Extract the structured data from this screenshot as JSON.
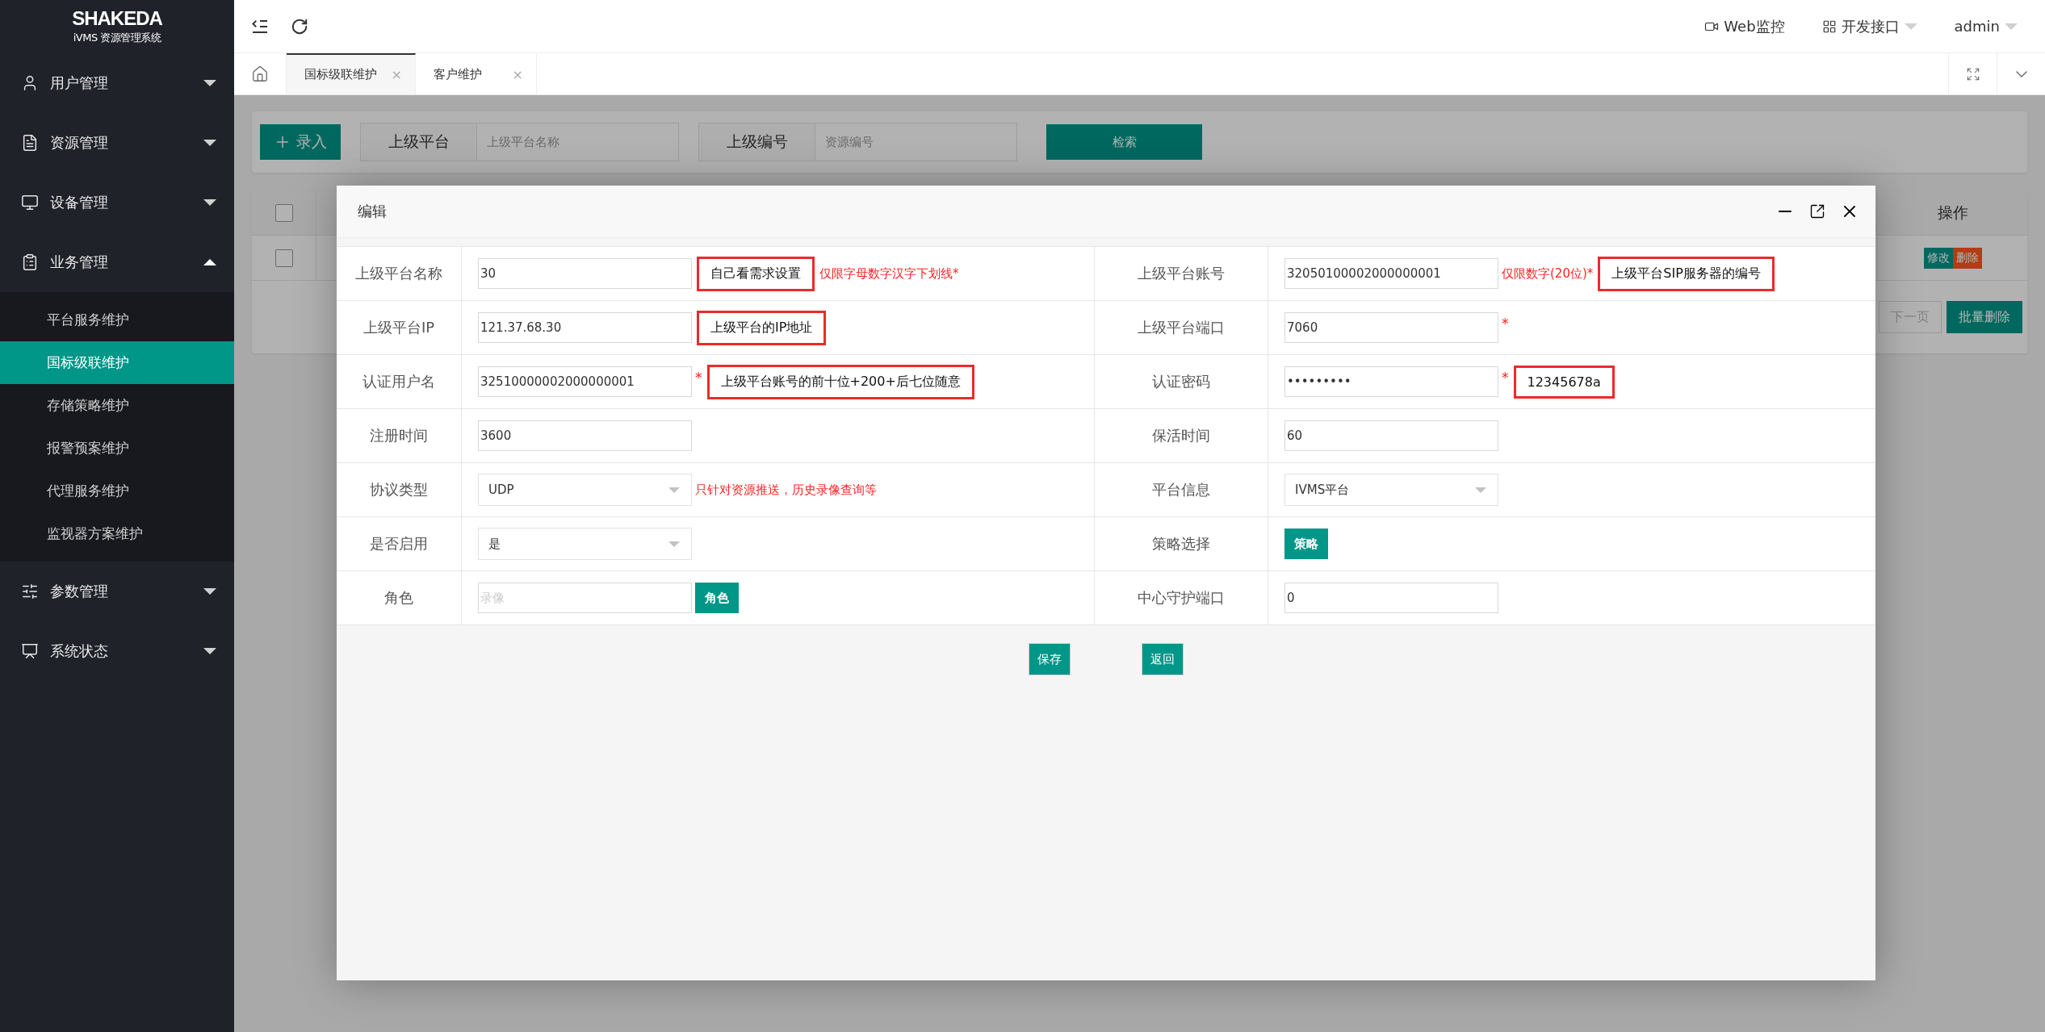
{
  "sidebar": {
    "logo": {
      "brand": "SHAKEDA",
      "subtitle": "iVMS 资源管理系统"
    },
    "items": [
      {
        "label": "用户管理",
        "expanded": false
      },
      {
        "label": "资源管理",
        "expanded": false
      },
      {
        "label": "设备管理",
        "expanded": false
      },
      {
        "label": "业务管理",
        "expanded": true,
        "children": [
          {
            "label": "平台服务维护",
            "selected": false
          },
          {
            "label": "国标级联维护",
            "selected": true
          },
          {
            "label": "存储策略维护",
            "selected": false
          },
          {
            "label": "报警预案维护",
            "selected": false
          },
          {
            "label": "代理服务维护",
            "selected": false
          },
          {
            "label": "监视器方案维护",
            "selected": false
          }
        ]
      },
      {
        "label": "参数管理",
        "expanded": false
      },
      {
        "label": "系统状态",
        "expanded": false
      }
    ]
  },
  "topbar": {
    "links": [
      {
        "label": "Web监控",
        "dropdown": false
      },
      {
        "label": "开发接口",
        "dropdown": true
      },
      {
        "label": "admin",
        "dropdown": true
      }
    ]
  },
  "tabs": [
    {
      "label": "国标级联维护",
      "close": "×",
      "selected": true
    },
    {
      "label": "客户维护",
      "close": "×",
      "selected": false
    }
  ],
  "toolbar": {
    "add_button": "录入",
    "filters": [
      {
        "label": "上级平台",
        "placeholder": "上级平台名称"
      },
      {
        "label": "上级编号",
        "placeholder": "资源编号"
      }
    ],
    "search_button": "检索"
  },
  "table": {
    "header_checked": false,
    "columns": [
      {
        "label": "操作"
      }
    ],
    "rows": [
      {
        "checked": false,
        "actions": [
          {
            "label": "修改",
            "kind": "edit"
          },
          {
            "label": "删除",
            "kind": "delete"
          }
        ]
      }
    ],
    "pager": {
      "next": "下一页",
      "batch_delete": "批量删除"
    }
  },
  "dialog": {
    "title": "编辑",
    "rows": [
      {
        "left": {
          "label": "上级平台名称",
          "kind": "input",
          "value": "30",
          "extras": [
            {
              "kind": "callout",
              "text": "自己看需求设置"
            },
            {
              "kind": "hint",
              "text": "仅限字母数字汉字下划线*"
            }
          ]
        },
        "right": {
          "label": "上级平台账号",
          "kind": "input",
          "value": "32050100002000000001",
          "extras": [
            {
              "kind": "hint",
              "text": "仅限数字(20位)*"
            },
            {
              "kind": "callout",
              "text": "上级平台SIP服务器的编号"
            }
          ]
        }
      },
      {
        "left": {
          "label": "上级平台IP",
          "kind": "input",
          "value": "121.37.68.30",
          "extras": [
            {
              "kind": "callout",
              "text": "上级平台的IP地址"
            }
          ]
        },
        "right": {
          "label": "上级平台端口",
          "kind": "input",
          "value": "7060",
          "extras": [
            {
              "kind": "star",
              "text": "*"
            }
          ]
        }
      },
      {
        "left": {
          "label": "认证用户名",
          "kind": "input",
          "value": "32510000002000000001",
          "extras": [
            {
              "kind": "star",
              "text": "*"
            },
            {
              "kind": "callout",
              "text": "上级平台账号的前十位+200+后七位随意"
            }
          ]
        },
        "right": {
          "label": "认证密码",
          "kind": "input",
          "value": "•••••••••",
          "extras": [
            {
              "kind": "star",
              "text": "*"
            },
            {
              "kind": "callout",
              "text": "12345678a"
            }
          ]
        }
      },
      {
        "left": {
          "label": "注册时间",
          "kind": "input",
          "value": "3600"
        },
        "right": {
          "label": "保活时间",
          "kind": "input",
          "value": "60"
        }
      },
      {
        "left": {
          "label": "协议类型",
          "kind": "select",
          "value": "UDP",
          "extras": [
            {
              "kind": "hint",
              "text": "只针对资源推送，历史录像查询等"
            }
          ]
        },
        "right": {
          "label": "平台信息",
          "kind": "select",
          "value": "IVMS平台"
        }
      },
      {
        "left": {
          "label": "是否启用",
          "kind": "select",
          "value": "是"
        },
        "right": {
          "label": "策略选择",
          "kind": "button",
          "button": "策略"
        }
      },
      {
        "left": {
          "label": "角色",
          "kind": "input_button",
          "placeholder": "录像",
          "button": "角色"
        },
        "right": {
          "label": "中心守护端口",
          "kind": "input",
          "value": "0"
        }
      }
    ],
    "buttons": [
      "保存",
      "返回"
    ]
  }
}
